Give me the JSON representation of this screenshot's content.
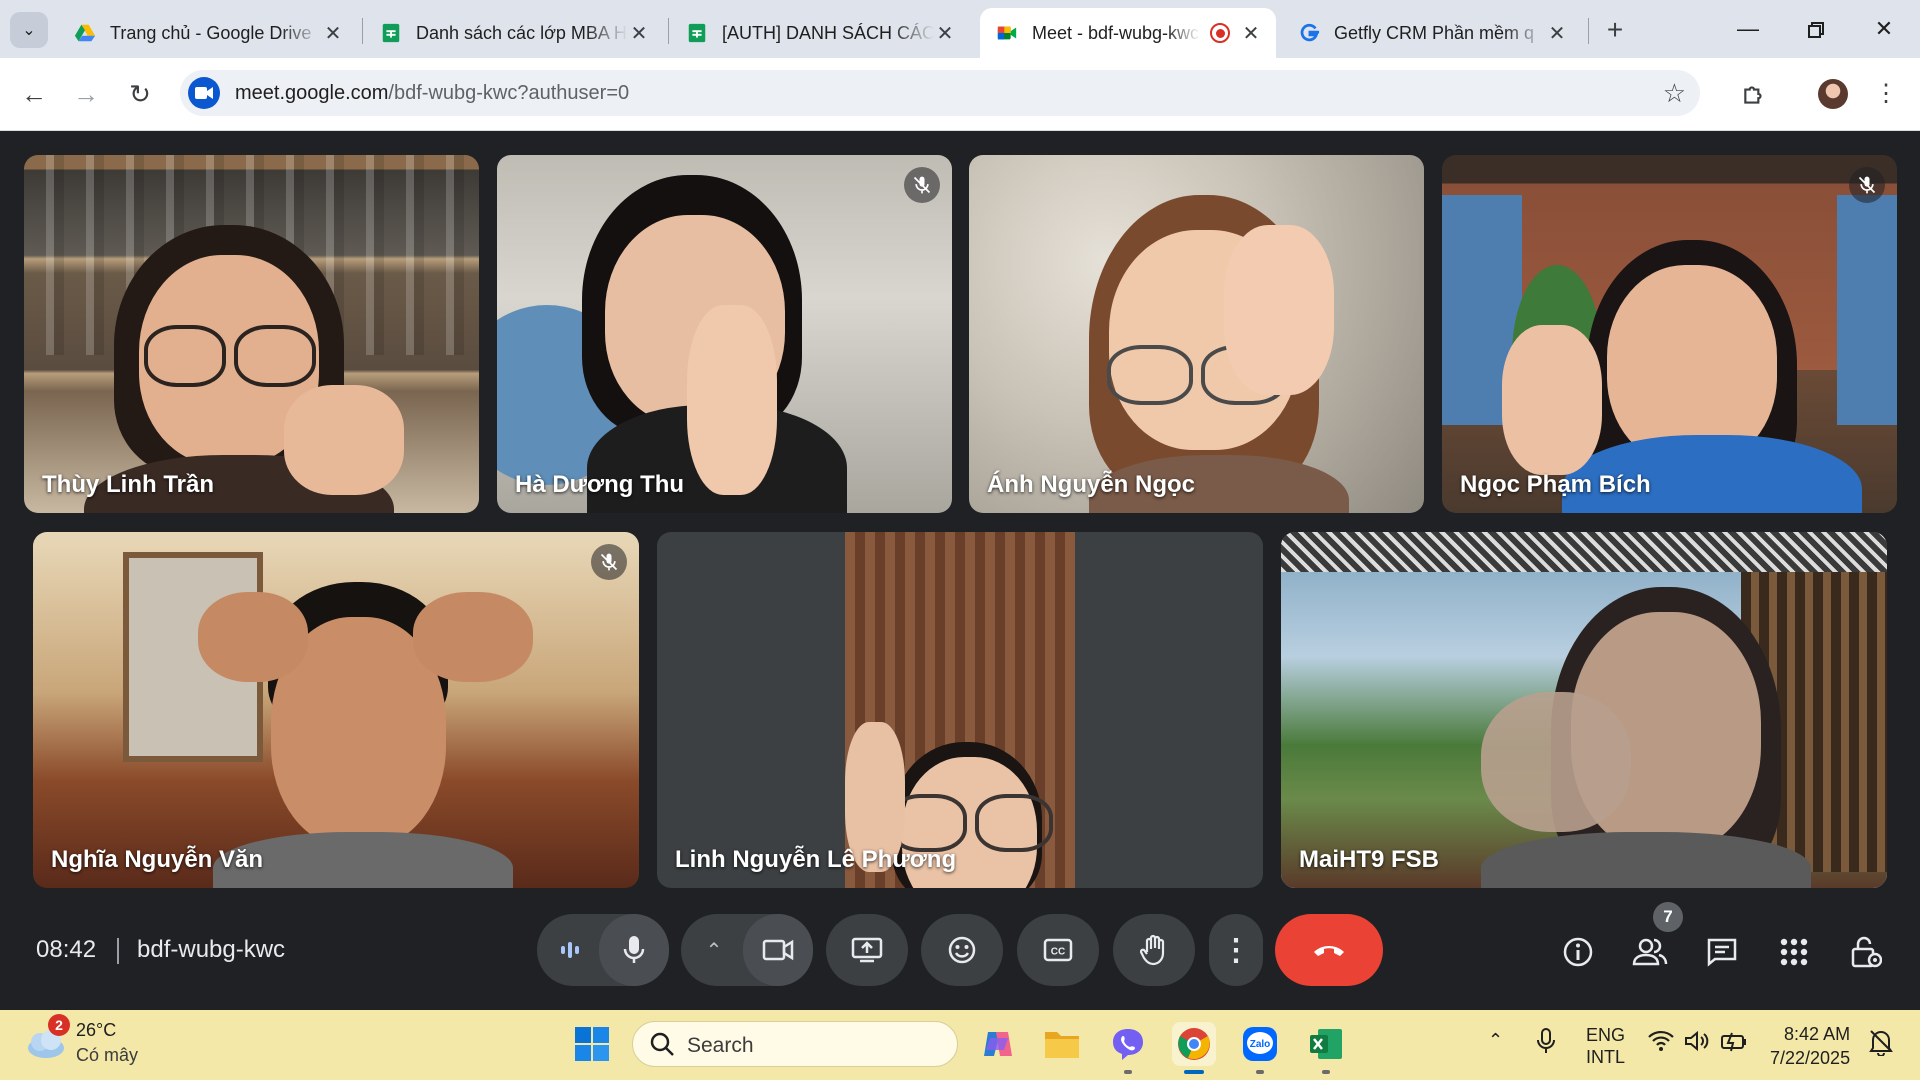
{
  "browser": {
    "tabs": [
      {
        "title": "Trang chủ - Google Drive",
        "icon": "google-drive-icon"
      },
      {
        "title": "Danh sách các lớp MBA H",
        "icon": "google-sheets-icon"
      },
      {
        "title": "[AUTH] DANH SÁCH CÁC",
        "icon": "google-sheets-icon"
      },
      {
        "title": "Meet - bdf-wubg-kwc",
        "icon": "google-meet-icon",
        "active": true
      },
      {
        "title": "Getfly CRM Phần mềm q",
        "icon": "getfly-icon"
      }
    ],
    "url_host": "meet.google.com",
    "url_path": "/bdf-wubg-kwc?authuser=0"
  },
  "participants": [
    {
      "name": "Thùy Linh Trần",
      "muted": false
    },
    {
      "name": "Hà Dương Thu",
      "muted": true
    },
    {
      "name": "Ánh Nguyễn Ngọc",
      "muted": false
    },
    {
      "name": "Ngọc Phạm Bích",
      "muted": true
    },
    {
      "name": "Nghĩa Nguyễn Văn",
      "muted": true
    },
    {
      "name": "Linh Nguyễn Lê Phương",
      "muted": false
    },
    {
      "name": "MaiHT9 FSB",
      "muted": false,
      "speaking": true
    }
  ],
  "meeting": {
    "time": "08:42",
    "code": "bdf-wubg-kwc",
    "people_count": "7"
  },
  "taskbar": {
    "weather_badge": "2",
    "weather_temp": "26°C",
    "weather_desc": "Có mây",
    "search_label": "Search",
    "lang_line1": "ENG",
    "lang_line2": "INTL",
    "clock_time": "8:42 AM",
    "clock_date": "7/22/2025"
  },
  "colors": {
    "meet_bg": "#202124",
    "control_bg": "#3c4043",
    "end_call": "#ea4335",
    "speaking_outline": "#a8c7fa",
    "taskbar_bg": "#f3e8a8"
  }
}
